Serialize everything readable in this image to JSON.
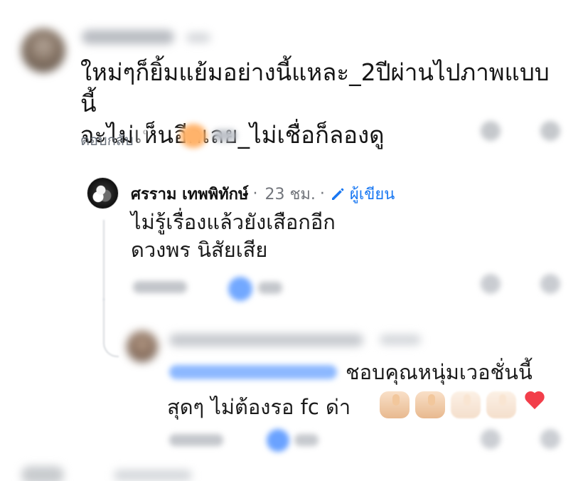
{
  "comment": {
    "text": "ใหม่ๆก็ยิ้มแย้มอย่างนี้แหละ_2ปีผ่านไปภาพแบบนี้\nจะไม่เห็นอีกเลย_ไม่เชื่อก็ลองดู",
    "reply_label": "ตอบกลับ"
  },
  "reply_1": {
    "author": "ศรราม เทพพิทักษ์",
    "time": "23 ชม.",
    "separator": "·",
    "author_badge": "ผู้เขียน",
    "text": "ไม่รู้เรื่องแล้วยังเสือกอีก\nดวงพร นิสัยเสีย"
  },
  "reply_2": {
    "text_line_1": "ชอบคุณหนุ่มเวอชั่นนี้",
    "text_line_2": "สุดๆ ไม่ต้องรอ fc ด่า"
  },
  "icons": {
    "author_badge_icon": "pen-icon",
    "reaction_icons": [
      "reaction-orange-icon",
      "reaction-blue-icon",
      "reaction-blue-icon"
    ],
    "emoji_icons": [
      "thumbs-up-icon",
      "thumbs-up-icon",
      "thumbs-up-icon",
      "thumbs-up-icon",
      "heart-icon"
    ]
  },
  "colors": {
    "author_badge": "#1877f2",
    "text_primary": "#1c1e21",
    "text_secondary": "#65676b",
    "mention_blue": "#8cb8ff",
    "heart_red": "#f23e4a"
  }
}
